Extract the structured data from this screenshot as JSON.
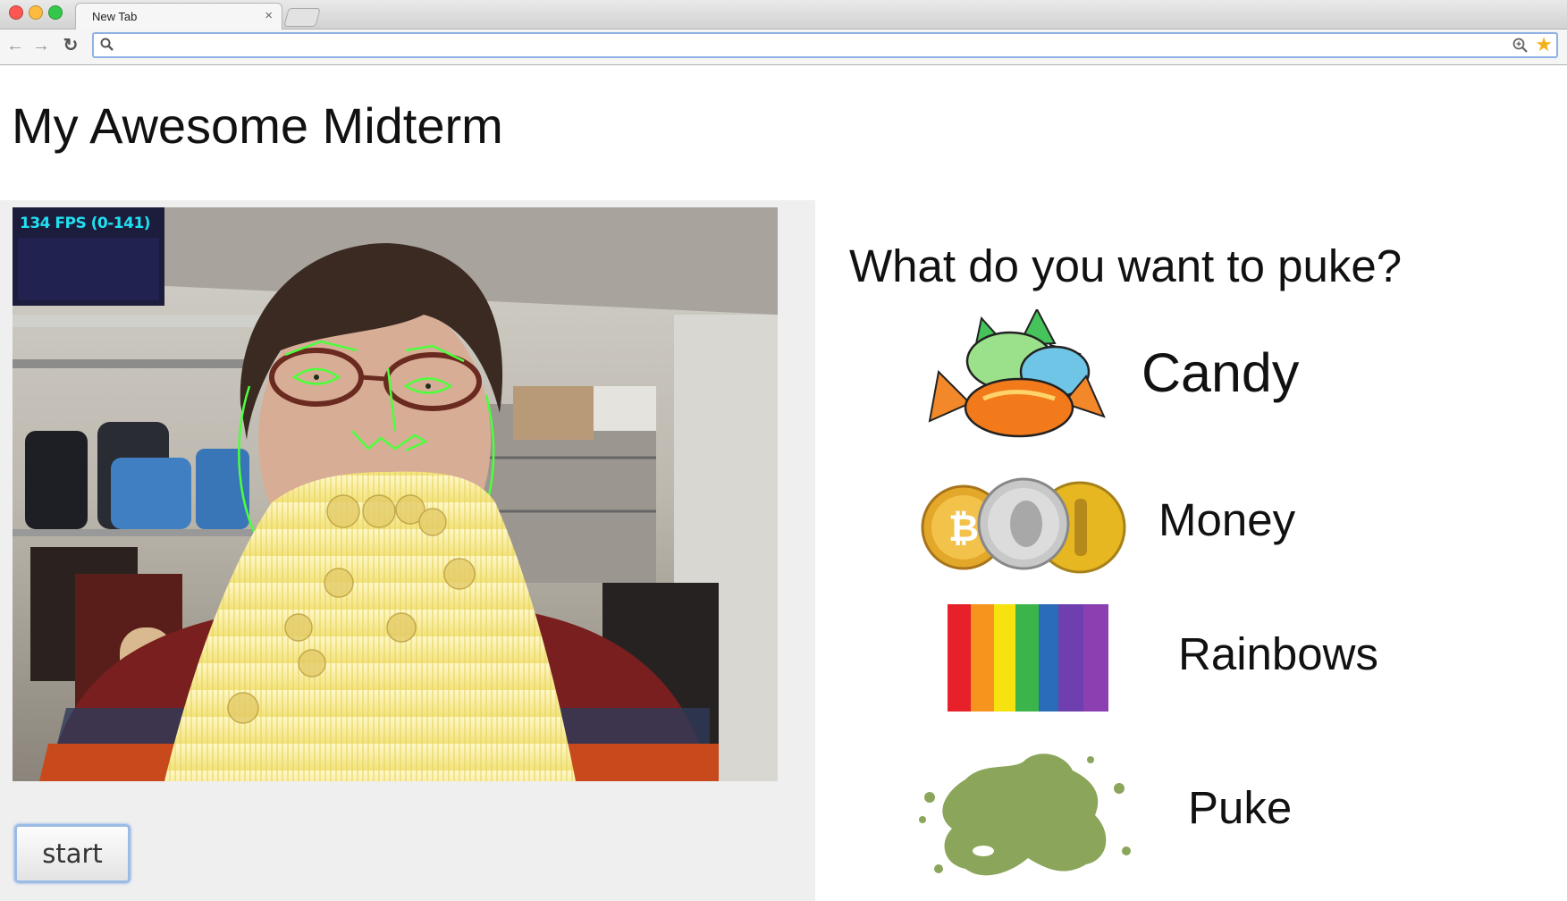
{
  "browser": {
    "tab_title": "New Tab",
    "tab_close": "×",
    "address_value": "",
    "star": "★",
    "back": "←",
    "forward": "→",
    "reload": "↻"
  },
  "page": {
    "title": "My Awesome Midterm"
  },
  "video": {
    "fps_label": "134 FPS (0-141)"
  },
  "controls": {
    "start_label": "start"
  },
  "question": {
    "text": "What do you want to puke?",
    "options": [
      {
        "label": "Candy",
        "icon": "candy-icon"
      },
      {
        "label": "Money",
        "icon": "coins-icon"
      },
      {
        "label": "Rainbows",
        "icon": "rainbow-icon"
      },
      {
        "label": "Puke",
        "icon": "puke-splat-icon"
      }
    ]
  },
  "colors": {
    "fps_text": "#20e0f0",
    "face_tracking": "#4cff3c",
    "rainbow": [
      "#e8202a",
      "#f7941d",
      "#f5e20f",
      "#3bb44a",
      "#2a6cb8",
      "#6f3fb0",
      "#8c3fb0"
    ],
    "puke": "#8ba55a"
  }
}
